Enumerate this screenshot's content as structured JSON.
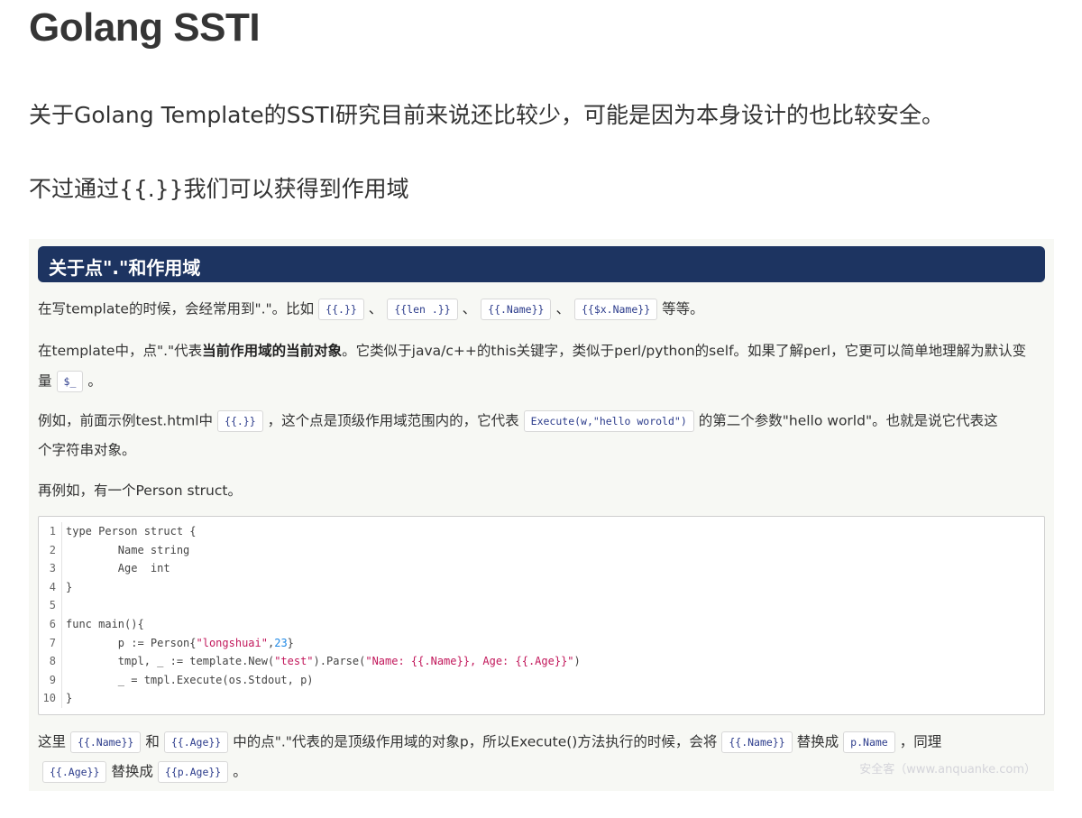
{
  "title": "Golang SSTI",
  "intro": {
    "p1": "关于Golang Template的SSTI研究目前来说还比较少，可能是因为本身设计的也比较安全。",
    "p2": "不过通过{{.}}我们可以获得到作用域"
  },
  "shot": {
    "banner": "关于点\".\"和作用域",
    "l1": {
      "a": "在写template的时候，会经常用到\".\"。比如",
      "c1": "{{.}}",
      "s1": "、",
      "c2": "{{len .}}",
      "s2": "、",
      "c3": "{{.Name}}",
      "s3": "、",
      "c4": "{{$x.Name}}",
      "b": "等等。"
    },
    "l2": {
      "a": "在template中，点\".\"代表",
      "bold": "当前作用域的当前对象",
      "b": "。它类似于java/c++的this关键字，类似于perl/python的self。如果了解perl，它更可以简单地理解为默认变"
    },
    "l3": {
      "a": "量",
      "c1": "$_",
      "b": "。"
    },
    "l4": {
      "a": "例如，前面示例test.html中",
      "c1": "{{.}}",
      "b": "，这个点是顶级作用域范围内的，它代表",
      "c2": "Execute(w,\"hello worold\")",
      "c": "的第二个参数\"hello world\"。也就是说它代表这"
    },
    "l5": {
      "a": "个字符串对象。"
    },
    "l6": {
      "a": "再例如，有一个Person struct。"
    },
    "code": {
      "lines": [
        {
          "n": "1",
          "t": "type Person struct {"
        },
        {
          "n": "2",
          "t": "        Name string"
        },
        {
          "n": "3",
          "t": "        Age  int"
        },
        {
          "n": "4",
          "t": "}"
        },
        {
          "n": "5",
          "t": ""
        },
        {
          "n": "6",
          "t": "func main(){"
        },
        {
          "n": "7",
          "pre": "        p := Person{",
          "str": "\"longshuai\"",
          "mid": ",",
          "num": "23",
          "post": "}"
        },
        {
          "n": "8",
          "pre": "        tmpl, _ := template.New(",
          "str": "\"test\"",
          "mid": ").Parse(",
          "str2": "\"Name: {{.Name}}, Age: {{.Age}}\"",
          "post": ")"
        },
        {
          "n": "9",
          "t": "        _ = tmpl.Execute(os.Stdout, p)"
        },
        {
          "n": "10",
          "t": "}"
        }
      ]
    },
    "l7": {
      "a": "这里",
      "c1": "{{.Name}}",
      "b": "和",
      "c2": "{{.Age}}",
      "c": "中的点\".\"代表的是顶级作用域的对象p，所以Execute()方法执行的时候，会将",
      "c3": "{{.Name}}",
      "d": "替换成",
      "c4": "p.Name",
      "e": "，同理"
    },
    "l8": {
      "c1": "{{.Age}}",
      "a": "替换成",
      "c2": "{{p.Age}}",
      "b": "。"
    },
    "watermark": "安全客（www.anquanke.com）"
  }
}
